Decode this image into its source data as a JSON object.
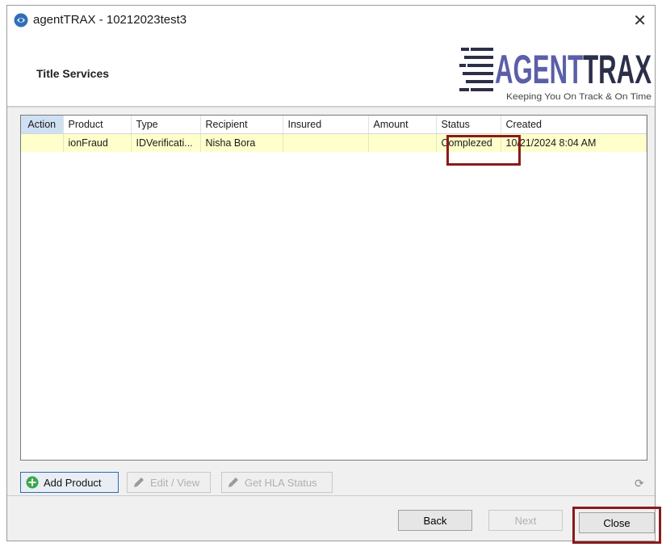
{
  "window": {
    "title": "agentTRAX - 10212023test3",
    "close_glyph": "✕"
  },
  "header": {
    "section_title": "Title Services",
    "logo": {
      "brand": "AGENTTRAX",
      "tagline": "Keeping You On Track & On Time"
    }
  },
  "grid": {
    "columns": [
      "Action",
      "Product",
      "Type",
      "Recipient",
      "Insured",
      "Amount",
      "Status",
      "Created"
    ],
    "rows": [
      {
        "action": "",
        "product": "ionFraud",
        "type": "IDVerificati...",
        "recipient": "Nisha Bora",
        "insured": "",
        "amount": "",
        "status": "Complezed",
        "created": "10/21/2024 8:04 AM"
      }
    ]
  },
  "toolbar": {
    "add_product": "Add Product",
    "edit_view": "Edit / View",
    "get_hla_status": "Get HLA Status"
  },
  "footer": {
    "back": "Back",
    "next": "Next",
    "close": "Close"
  },
  "colors": {
    "selected_row": "#ffffcc",
    "highlight_box": "#8b1a1a",
    "logo_dark": "#2b2f4a",
    "logo_accent": "#5b5fa8"
  },
  "icons": {
    "app": "globe-icon",
    "add": "plus-circle-icon",
    "edit": "pencil-icon",
    "refresh": "refresh-icon"
  }
}
